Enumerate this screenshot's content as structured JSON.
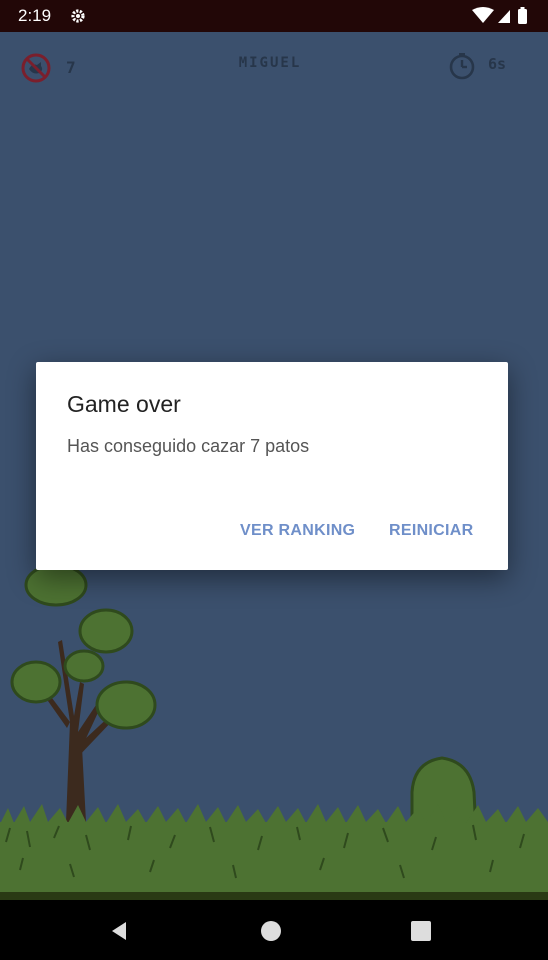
{
  "status_bar": {
    "time": "2:19"
  },
  "hud": {
    "ducks_count": "7",
    "player_name": "MIGUEL",
    "time_left": "6s"
  },
  "dialog": {
    "title": "Game over",
    "message": "Has conseguido cazar 7 patos",
    "ranking_button": "VER RANKING",
    "restart_button": "REINICIAR"
  },
  "colors": {
    "sky": "#3b506d",
    "accent": "#6f8fc9",
    "grass": "#4d7232",
    "status_bar": "#220707"
  },
  "icons": [
    "settings-icon",
    "wifi-icon",
    "signal-icon",
    "battery-icon",
    "no-duck-icon",
    "timer-icon",
    "back-icon",
    "home-icon",
    "recents-icon"
  ]
}
